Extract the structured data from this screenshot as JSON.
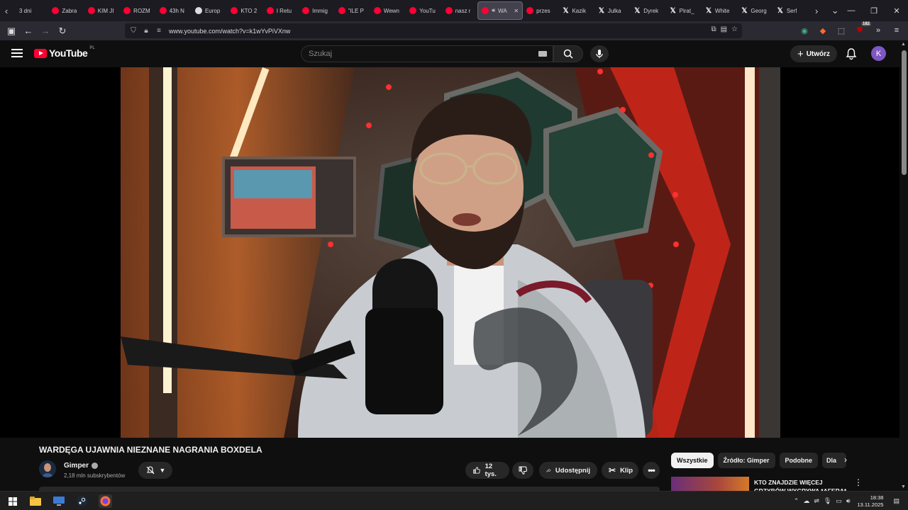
{
  "browser": {
    "tabs": [
      {
        "label": "3 dni",
        "icon": "none"
      },
      {
        "label": "Zabra",
        "icon": "youtube"
      },
      {
        "label": "KIM JI",
        "icon": "youtube"
      },
      {
        "label": "ROZM",
        "icon": "youtube"
      },
      {
        "label": "43h N",
        "icon": "youtube"
      },
      {
        "label": "Europ",
        "icon": "globe"
      },
      {
        "label": "KTO 2",
        "icon": "youtube"
      },
      {
        "label": "I Retu",
        "icon": "youtube"
      },
      {
        "label": "Immig",
        "icon": "youtube"
      },
      {
        "label": "\"ILE P",
        "icon": "youtube"
      },
      {
        "label": "Wewn",
        "icon": "youtube"
      },
      {
        "label": "YouTu",
        "icon": "youtube"
      },
      {
        "label": "nasz r",
        "icon": "youtube"
      },
      {
        "label": "WA",
        "icon": "youtube",
        "active": true
      },
      {
        "label": "przes",
        "icon": "youtube"
      },
      {
        "label": "Kazik",
        "icon": "x"
      },
      {
        "label": "Julka",
        "icon": "x"
      },
      {
        "label": "Dyrek",
        "icon": "x"
      },
      {
        "label": "Pirat_",
        "icon": "x"
      },
      {
        "label": "White",
        "icon": "x"
      },
      {
        "label": "Georg",
        "icon": "x"
      },
      {
        "label": "Serf",
        "icon": "x"
      }
    ],
    "url": "www.youtube.com/watch?v=k1wYvPiVXnw",
    "extensions_badge": "182"
  },
  "youtube": {
    "logo_text": "YouTube",
    "region": "PL",
    "search_placeholder": "Szukaj",
    "create_label": "Utwórz",
    "avatar_letter": "K"
  },
  "video": {
    "title": "WARDĘGA UJAWNIA NIEZNANE NAGRANIA BOXDELA",
    "channel": "Gimper",
    "subscribers": "2,18 mln subskrybentów",
    "likes": "12 tys.",
    "share_label": "Udostępnij",
    "clip_label": "Klip"
  },
  "sidebar": {
    "chips": [
      "Wszystkie",
      "Źródło: Gimper",
      "Podobne",
      "Dla"
    ],
    "recommendation_title": "KTO ZNAJDZIE WIĘCEJ GRZYBÓW WYGRYWA *AFERA*"
  },
  "taskbar": {
    "time": "18:38",
    "date": "13.11.2025"
  },
  "colors": {
    "yt_red": "#ff0033",
    "bg": "#0f0f0f",
    "avatar": "#7e57c2"
  }
}
